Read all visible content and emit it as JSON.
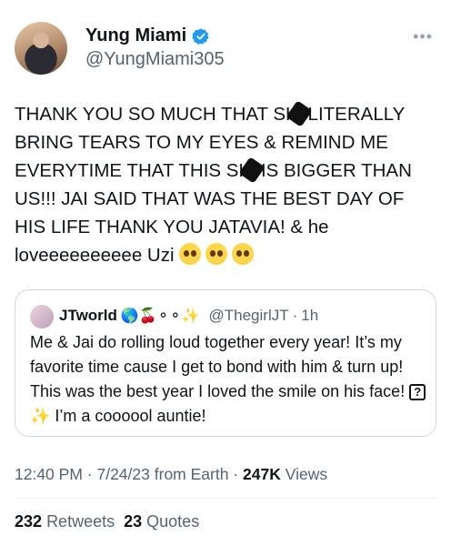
{
  "author": {
    "display_name": "Yung Miami",
    "handle": "@YungMiami305",
    "verified": true,
    "avatar_icon": "profile-photo"
  },
  "tweet": {
    "line1a": "THANK YOU SO MUCH THAT SH",
    "line1b": " LITERALLY",
    "line2": "BRING TEARS TO MY EYES & REMIND ME",
    "line3a": "EVERYTIME THAT THIS SH",
    "line3b": " IS BIGGER THAN",
    "line4": "US!!! JAI SAID THAT WAS THE BEST DAY OF",
    "line5": "HIS LIFE THANK YOU JATAVIA! & he",
    "line6": "loveeeeeeeeee Uzi",
    "emojis": [
      "pleading-face",
      "pleading-face",
      "pleading-face"
    ]
  },
  "quote": {
    "name": "JTworld",
    "name_emojis": "🌎🍒⚬⚬✨",
    "handle": "@ThegirlJT",
    "separator": "·",
    "time": "1h",
    "text_a": "Me & Jai do rolling loud together every year! It’s my favorite time cause I get to bond with him & turn up! This was the best year I loved the smile on his face! ",
    "text_b": "✨ I’m a coooool auntie!"
  },
  "meta": {
    "time": "12:40 PM",
    "date": "7/24/23",
    "source": "from Earth",
    "separator": "·",
    "views_count": "247K",
    "views_label": "Views"
  },
  "stats": {
    "retweets_count": "232",
    "retweets_label": "Retweets",
    "quotes_count": "23",
    "quotes_label": "Quotes"
  },
  "colors": {
    "verified": "#1d9bf0",
    "secondary_text": "#536471",
    "border": "#cfd9de"
  }
}
